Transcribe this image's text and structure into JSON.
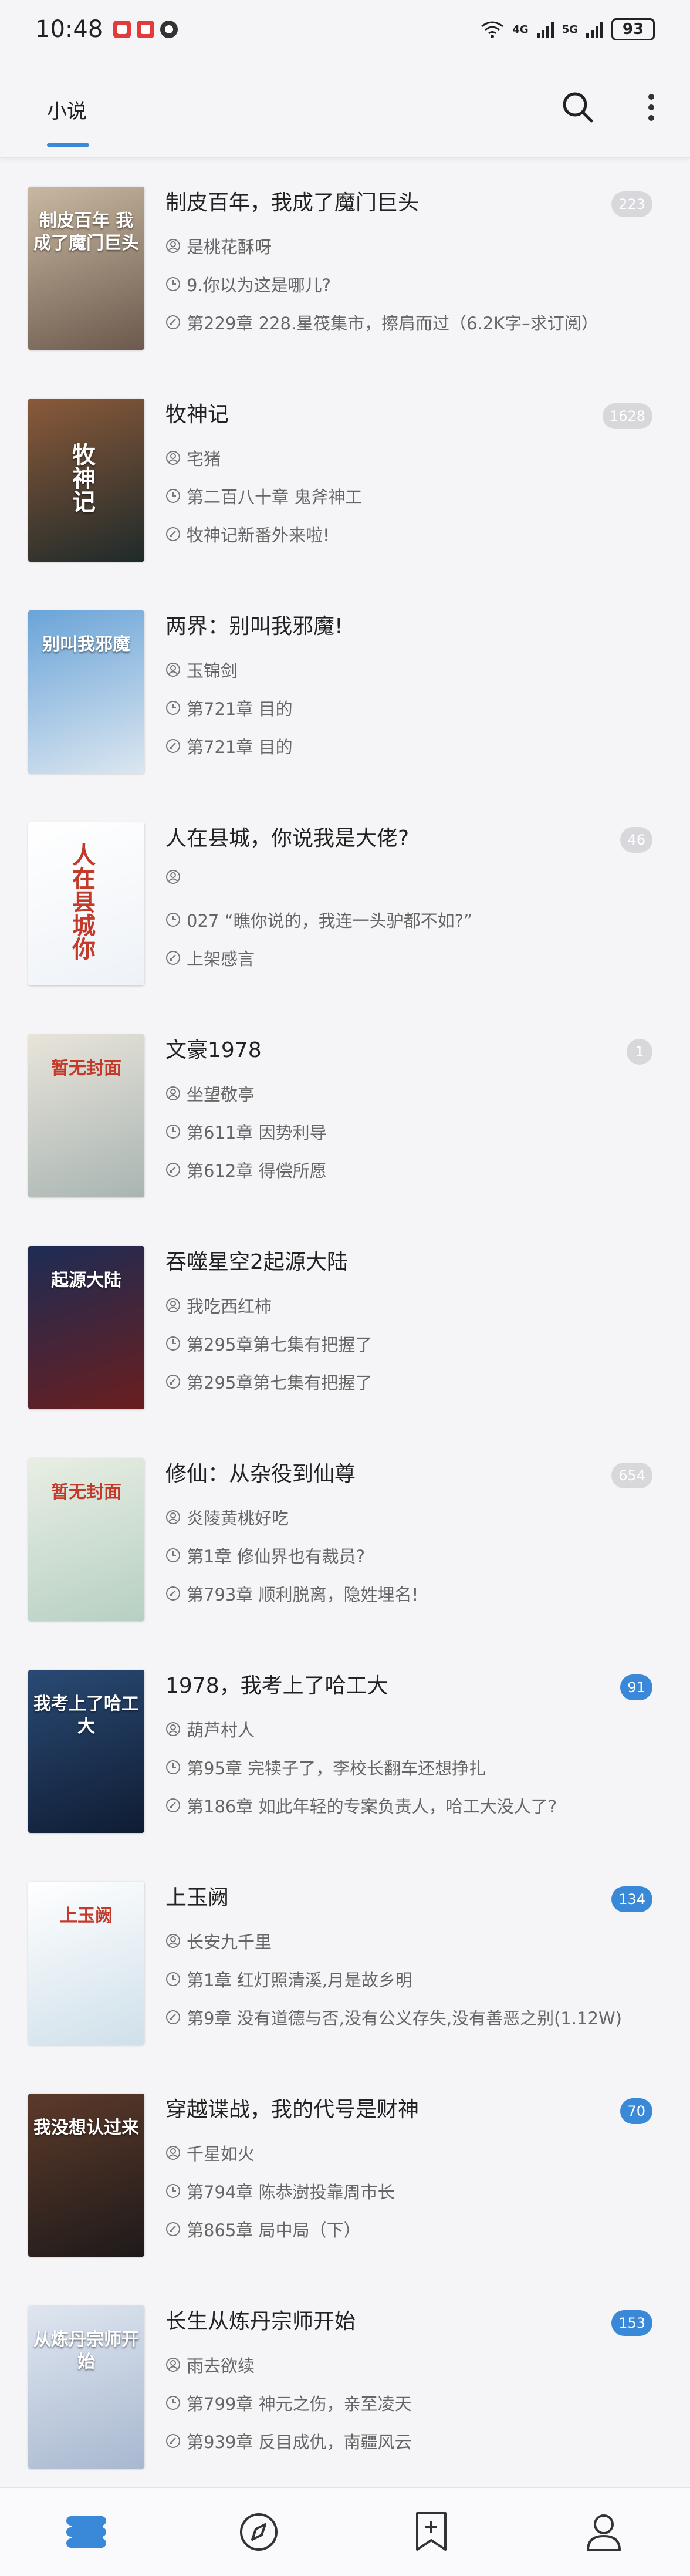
{
  "status_bar": {
    "time": "10:48",
    "network1": "4G",
    "network2": "5G",
    "battery": "93"
  },
  "app_bar": {
    "tab_label": "小说"
  },
  "books": [
    {
      "title": "制皮百年，我成了魔门巨头",
      "author": "是桃花酥呀",
      "latest_read": "9.你以为这是哪儿?",
      "latest_chapter": "第229章 228.星筏集市，擦肩而过（6.2K字–求订阅）",
      "count": "223",
      "count_style": "grey",
      "cover_text": "制皮百年\n我成了魔门巨头",
      "cover_colors": [
        "#c9b8a1",
        "#6b5a4d"
      ]
    },
    {
      "title": "牧神记",
      "author": "宅猪",
      "latest_read": "第二百八十章 鬼斧神工",
      "latest_chapter": "牧神记新番外来啦!",
      "count": "1628",
      "count_style": "grey",
      "cover_text": "牧神记",
      "cover_colors": [
        "#8a5a3a",
        "#1f2a2a"
      ]
    },
    {
      "title": "两界：别叫我邪魔!",
      "author": "玉锦剑",
      "latest_read": "第721章 目的",
      "latest_chapter": "第721章 目的",
      "count": "",
      "count_style": "none",
      "cover_text": "别叫我邪魔",
      "cover_colors": [
        "#6aa4d8",
        "#dbe6f0"
      ]
    },
    {
      "title": "人在县城，你说我是大佬?",
      "author": "",
      "latest_read": "027 “瞧你说的，我连一头驴都不如?”",
      "latest_chapter": "上架感言",
      "count": "46",
      "count_style": "grey",
      "cover_text": "人在县城你",
      "cover_colors": [
        "#ffffff",
        "#eef2f7"
      ]
    },
    {
      "title": "文豪1978",
      "author": "坐望敬亭",
      "latest_read": "第611章 因势利导",
      "latest_chapter": "第612章 得偿所愿",
      "count": "1",
      "count_style": "grey",
      "cover_text": "暂无封面",
      "cover_colors": [
        "#e8e4da",
        "#a9b5b2"
      ]
    },
    {
      "title": "吞噬星空2起源大陆",
      "author": "我吃西红柿",
      "latest_read": "第295章第七集有把握了",
      "latest_chapter": "第295章第七集有把握了",
      "count": "",
      "count_style": "none",
      "cover_text": "起源大陆",
      "cover_colors": [
        "#1d2c55",
        "#6a1e1e"
      ]
    },
    {
      "title": "修仙：从杂役到仙尊",
      "author": "炎陵黄桃好吃",
      "latest_read": "第1章 修仙界也有裁员?",
      "latest_chapter": "第793章 顺利脱离，隐姓埋名!",
      "count": "654",
      "count_style": "grey",
      "cover_text": "暂无封面",
      "cover_colors": [
        "#e9eee4",
        "#b6d0c2"
      ]
    },
    {
      "title": "1978，我考上了哈工大",
      "author": "葫芦村人",
      "latest_read": "第95章 完犊子了，李校长翻车还想挣扎",
      "latest_chapter": "第186章 如此年轻的专案负责人，哈工大没人了?",
      "count": "91",
      "count_style": "blue",
      "cover_text": "我考上了哈工大",
      "cover_colors": [
        "#2a4a74",
        "#0f1c33"
      ]
    },
    {
      "title": "上玉阙",
      "author": "长安九千里",
      "latest_read": "第1章 红灯照清溪,月是故乡明",
      "latest_chapter": "第9章 没有道德与否,没有公义存失,没有善恶之别(1.12W)",
      "count": "134",
      "count_style": "blue",
      "cover_text": "上玉阙",
      "cover_colors": [
        "#ffffff",
        "#cfe0ea"
      ]
    },
    {
      "title": "穿越谍战，我的代号是财神",
      "author": "千星如火",
      "latest_read": "第794章 陈恭澍投靠周市长",
      "latest_chapter": "第865章 局中局（下）",
      "count": "70",
      "count_style": "blue",
      "cover_text": "我没想认过来",
      "cover_colors": [
        "#5c3a2a",
        "#1e1a1a"
      ]
    },
    {
      "title": "长生从炼丹宗师开始",
      "author": "雨去欲续",
      "latest_read": "第799章 神元之伤，亲至凌天",
      "latest_chapter": "第939章 反目成仇，南疆风云",
      "count": "153",
      "count_style": "blue",
      "cover_text": "从炼丹宗师开始",
      "cover_colors": [
        "#dfe6f0",
        "#a8b8d0"
      ]
    }
  ],
  "bottom_nav": [
    "bookshelf-icon",
    "compass-icon",
    "bookmark-add-icon",
    "profile-icon"
  ]
}
